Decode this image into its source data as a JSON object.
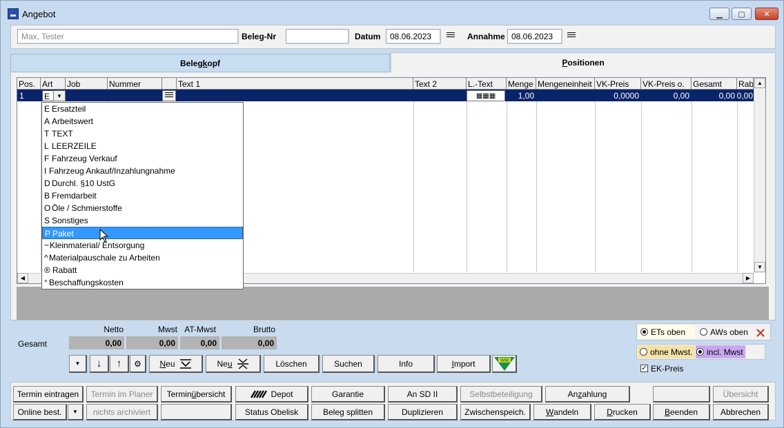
{
  "window": {
    "title": "Angebot"
  },
  "header": {
    "customer_placeholder": "Max, Tester",
    "beleg_nr_label": "Beleg-Nr",
    "beleg_nr_value": "",
    "datum_label": "Datum",
    "datum_value": "08.06.2023",
    "annahme_label": "Annahme",
    "annahme_value": "08.06.2023"
  },
  "tabs": [
    {
      "label_pre": "Beleg",
      "label_u": "k",
      "label_post": "opf"
    },
    {
      "label_pre": "",
      "label_u": "P",
      "label_post": "ositionen"
    }
  ],
  "grid": {
    "columns": [
      "Pos.",
      "Art",
      "Job",
      "Nummer",
      "",
      "Text 1",
      "Text 2",
      "L.-Text",
      "Menge",
      "Mengeneinheit",
      "VK-Preis",
      "VK-Preis o.",
      "Gesamt",
      "Rab"
    ],
    "row": {
      "pos": "1",
      "art": "E",
      "menge": "1,00",
      "vk_preis": "0,0000",
      "vk_preis_o": "0,00",
      "gesamt": "0,00",
      "rab": "0,00"
    }
  },
  "art_dropdown": [
    {
      "code": "E",
      "label": "Ersatzteil"
    },
    {
      "code": "A",
      "label": "Arbeitswert"
    },
    {
      "code": "T",
      "label": "TEXT"
    },
    {
      "code": "L",
      "label": "LEERZEILE"
    },
    {
      "code": "F",
      "label": "Fahrzeug Verkauf"
    },
    {
      "code": "I",
      "label": "Fahrzeug Ankauf/Inzahlungnahme"
    },
    {
      "code": "D",
      "label": "Durchl. §10 UstG"
    },
    {
      "code": "B",
      "label": "Fremdarbeit"
    },
    {
      "code": "O",
      "label": "Öle / Schmierstoffe"
    },
    {
      "code": "S",
      "label": "Sonstiges"
    },
    {
      "code": "P",
      "label": "Paket"
    },
    {
      "code": "~",
      "label": "Kleinmaterial/ Entsorgung"
    },
    {
      "code": "^",
      "label": "Materialpauschale zu Arbeiten"
    },
    {
      "code": "®",
      "label": "Rabatt"
    },
    {
      "code": "°",
      "label": "Beschaffungskosten"
    }
  ],
  "totals": {
    "gesamt_label": "Gesamt",
    "headers": [
      "Netto",
      "Mwst",
      "AT-Mwst",
      "Brutto"
    ],
    "values": [
      "0,00",
      "0,00",
      "0,00",
      "0,00"
    ]
  },
  "actions": {
    "neu1_pre": "",
    "neu1_u": "N",
    "neu1_post": "eu",
    "neu2_pre": "Ne",
    "neu2_u": "u",
    "neu2_post": "",
    "loeschen": "Löschen",
    "suchen": "Suchen",
    "info": "Info",
    "import_pre": "",
    "import_u": "I",
    "import_post": "mport",
    "wm_logo": "WM"
  },
  "options": {
    "ets_oben": "ETs oben",
    "aws_oben": "AWs oben",
    "ohne_mwst": "ohne Mwst.",
    "incl_mwst": "incl. Mwst",
    "ek_preis": "EK-Preis"
  },
  "bottom_row1": {
    "termin_eintragen": "Termin eintragen",
    "termin_im_planer": "Termin im Planer",
    "terminuebersicht_pre": "Termin",
    "terminuebersicht_u": "ü",
    "terminuebersicht_post": "bersicht",
    "depot": "Depot",
    "garantie": "Garantie",
    "an_sd_ii": "An SD II",
    "selbstbeteiligung": "Selbstbeteiligung",
    "anzahlung_pre": "An",
    "anzahlung_u": "z",
    "anzahlung_post": "ahlung",
    "empty": "",
    "uebersicht": "Übersicht"
  },
  "bottom_row2": {
    "online_best": "Online best.",
    "nichts_archiviert": "nichts archiviert",
    "empty": "",
    "status_obelisk": "Status Obelisk",
    "beleg_splitten": "Beleg splitten",
    "duplizieren": "Duplizieren",
    "zwischenspeich": "Zwischenspeich.",
    "wandeln_pre": "",
    "wandeln_u": "W",
    "wandeln_post": "andeln",
    "drucken_pre": "",
    "drucken_u": "D",
    "drucken_post": "rucken",
    "beenden_pre": "",
    "beenden_u": "B",
    "beenden_post": "eenden",
    "abbrechen": "Abbrechen"
  },
  "colors": {
    "selection_row": "#0a246a",
    "dropdown_highlight": "#3399ff",
    "close_x": "#c0392b",
    "incl_mwst_bg": "#c8a7f0",
    "ohne_mwst_bg": "#f3e3a8",
    "ets_oben_bg": "#fffde8"
  },
  "icons": [
    "app-icon",
    "menu-lines-icon",
    "chevron-down-icon",
    "arrow-down-icon",
    "arrow-up-icon",
    "gear-icon",
    "close-x-icon",
    "tire-icon",
    "mouse-cursor-icon"
  ]
}
